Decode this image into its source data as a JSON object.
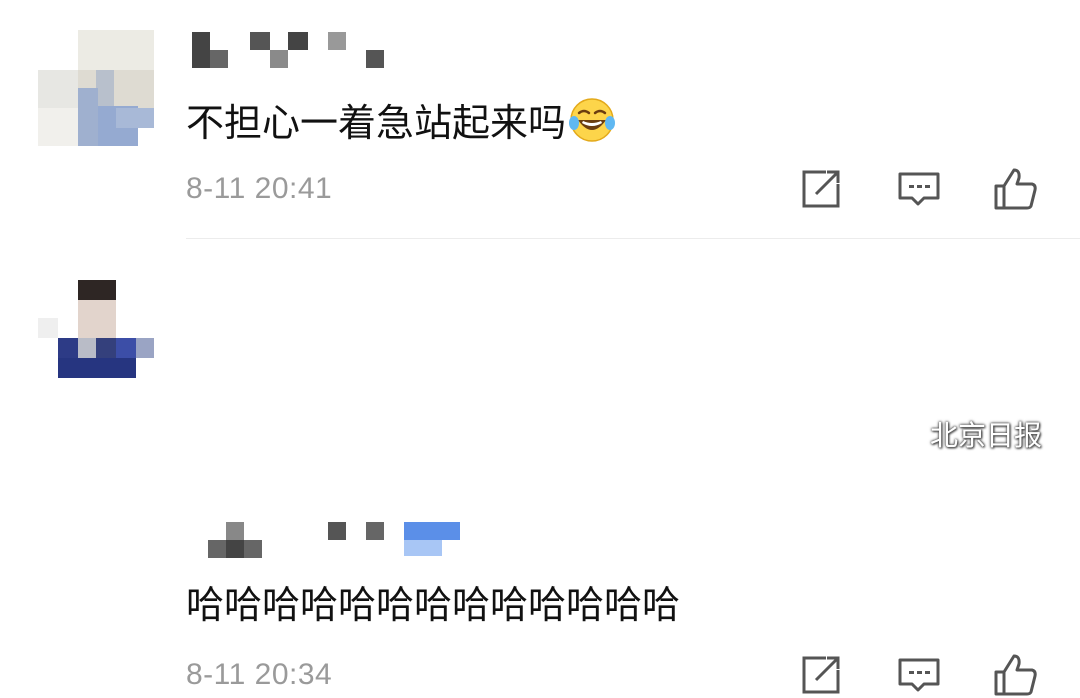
{
  "comments": [
    {
      "text": "不担心一着急站起来吗",
      "emoji": "laughing-tears-emoji",
      "time": "8-11 20:41"
    },
    {
      "text": "哈哈哈哈哈哈哈哈哈哈哈哈哈",
      "time": "8-11 20:34"
    }
  ],
  "watermark": {
    "text": "北京日报"
  },
  "colors": {
    "time": "#9a9a9a",
    "icon": "#555555",
    "divider": "#ececec",
    "text": "#111111"
  }
}
